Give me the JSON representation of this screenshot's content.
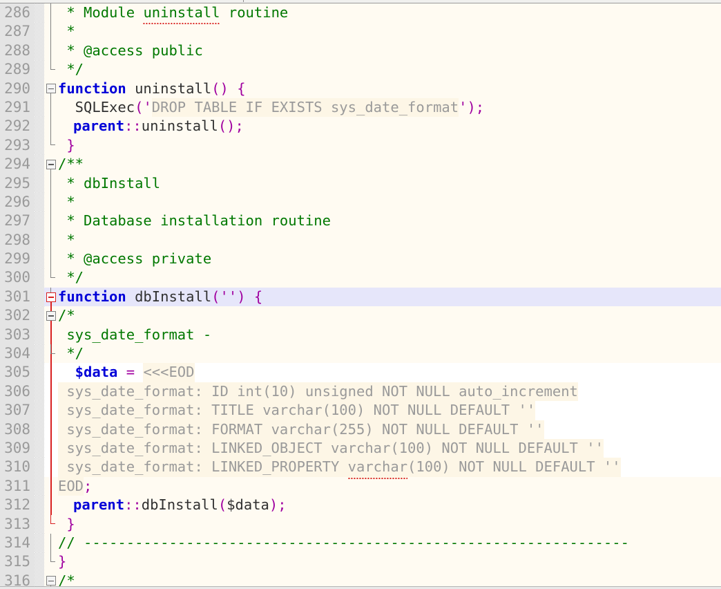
{
  "editor": {
    "language": "PHP",
    "first_line_number": 286,
    "current_line": 301,
    "theme": {
      "background": "#fffbf2",
      "gutter_background": "#e4e4e4",
      "gutter_text": "#9a9a9a",
      "current_line_highlight": "#e6e6fa",
      "string_background": "#fdf6e6",
      "comment": "#007800",
      "keyword": "#0000d8",
      "punctuation": "#a000a0",
      "string": "#9a9a9a",
      "variable": "#0000d8",
      "fold_marker": "#808080",
      "fold_marker_active": "#d81f1f",
      "spellcheck_underline": "#d81f1f"
    }
  },
  "lines": [
    {
      "number": "286",
      "text": " * Module uninstall routine"
    },
    {
      "number": "287",
      "text": " *"
    },
    {
      "number": "288",
      "text": " * @access public"
    },
    {
      "number": "289",
      "text": " */"
    },
    {
      "number": "290",
      "text": " function uninstall() {"
    },
    {
      "number": "291",
      "text": "   SQLExec('DROP TABLE IF EXISTS sys_date_format');"
    },
    {
      "number": "292",
      "text": "   parent::uninstall();"
    },
    {
      "number": "293",
      "text": "  }"
    },
    {
      "number": "294",
      "text": "/**"
    },
    {
      "number": "295",
      "text": " * dbInstall"
    },
    {
      "number": "296",
      "text": " *"
    },
    {
      "number": "297",
      "text": " * Database installation routine"
    },
    {
      "number": "298",
      "text": " *"
    },
    {
      "number": "299",
      "text": " * @access private"
    },
    {
      "number": "300",
      "text": " */"
    },
    {
      "number": "301",
      "text": " function dbInstall('') {"
    },
    {
      "number": "302",
      "text": "/*"
    },
    {
      "number": "303",
      "text": " sys_date_format -"
    },
    {
      "number": "304",
      "text": " */"
    },
    {
      "number": "305",
      "text": "   $data = <<<EOD"
    },
    {
      "number": "306",
      "text": " sys_date_format: ID int(10) unsigned NOT NULL auto_increment"
    },
    {
      "number": "307",
      "text": " sys_date_format: TITLE varchar(100) NOT NULL DEFAULT ''"
    },
    {
      "number": "308",
      "text": " sys_date_format: FORMAT varchar(255) NOT NULL DEFAULT ''"
    },
    {
      "number": "309",
      "text": " sys_date_format: LINKED_OBJECT varchar(100) NOT NULL DEFAULT ''"
    },
    {
      "number": "310",
      "text": " sys_date_format: LINKED_PROPERTY varchar(100) NOT NULL DEFAULT ''"
    },
    {
      "number": "311",
      "text": "EOD;"
    },
    {
      "number": "312",
      "text": "   parent::dbInstall($data);"
    },
    {
      "number": "313",
      "text": "  }"
    },
    {
      "number": "314",
      "text": "// ----------------------------------------------------------------"
    },
    {
      "number": "315",
      "text": "}"
    },
    {
      "number": "316",
      "text": "/*"
    }
  ],
  "tokens": {
    "l286": {
      "star": " * ",
      "body": "Module ",
      "misspelled": "uninstall",
      "tail": " routine"
    },
    "l287": {
      "star": " *"
    },
    "l288": {
      "star": " * ",
      "body": "@access public"
    },
    "l289": {
      "star": " */"
    },
    "l290": {
      "kw": "function",
      "name": " uninstall",
      "p1": "()",
      "brace": " {"
    },
    "l291": {
      "call": "  SQLExec",
      "paren_open": "(",
      "quote_open": "'",
      "sql": "DROP TABLE IF EXISTS sys_date_format",
      "quote_close": "'",
      "paren_close": ")",
      "semi": ";"
    },
    "l292": {
      "kw": "parent",
      "dcolon": "::",
      "name": "uninstall",
      "p": "()",
      "semi": ";"
    },
    "l293": {
      "brace": " }"
    },
    "l294": {
      "c": "/**"
    },
    "l295": {
      "c": " * dbInstall"
    },
    "l296": {
      "c": " *"
    },
    "l297": {
      "c": " * Database installation routine"
    },
    "l298": {
      "c": " *"
    },
    "l299": {
      "c": " * @access private"
    },
    "l300": {
      "c": " */"
    },
    "l301": {
      "kw": "function",
      "name": " dbInstall",
      "paren_open": "(",
      "quotes": "''",
      "paren_close": ")",
      "brace": " {"
    },
    "l302": {
      "c": "/*"
    },
    "l303": {
      "c": " sys_date_format -"
    },
    "l304": {
      "c": " */"
    },
    "l305": {
      "var": "  $data",
      "eq": " = ",
      "heredoc": "<<<EOD"
    },
    "l306": {
      "pre": " sys_date_format: ID ",
      "misspelled": "int",
      "post": "(10) unsigned NOT NULL auto_increment"
    },
    "l307": {
      "pre": " sys_date_format: TITLE ",
      "misspelled": "varchar",
      "post": "(100) NOT NULL DEFAULT ''"
    },
    "l308": {
      "pre": " sys_date_format: FORMAT ",
      "misspelled": "varchar",
      "post": "(255) NOT NULL DEFAULT ''"
    },
    "l309": {
      "pre": " sys_date_format: LINKED_OBJECT ",
      "misspelled": "varchar",
      "post": "(100) NOT NULL DEFAULT ''"
    },
    "l310": {
      "pre": " sys_date_format: LINKED_PROPERTY ",
      "misspelled": "varchar",
      "post": "(100) NOT NULL DEFAULT ''"
    },
    "l311": {
      "eod": "EOD",
      "semi": ";"
    },
    "l312": {
      "kw": "parent",
      "dcolon": "::",
      "name": "dbInstall",
      "paren_open": "(",
      "var": "$data",
      "paren_close": ")",
      "semi": ";"
    },
    "l313": {
      "brace": " }"
    },
    "l314": {
      "c": "// ----------------------------------------------------------------"
    },
    "l315": {
      "brace": "}"
    },
    "l316": {
      "c": "/*"
    }
  }
}
